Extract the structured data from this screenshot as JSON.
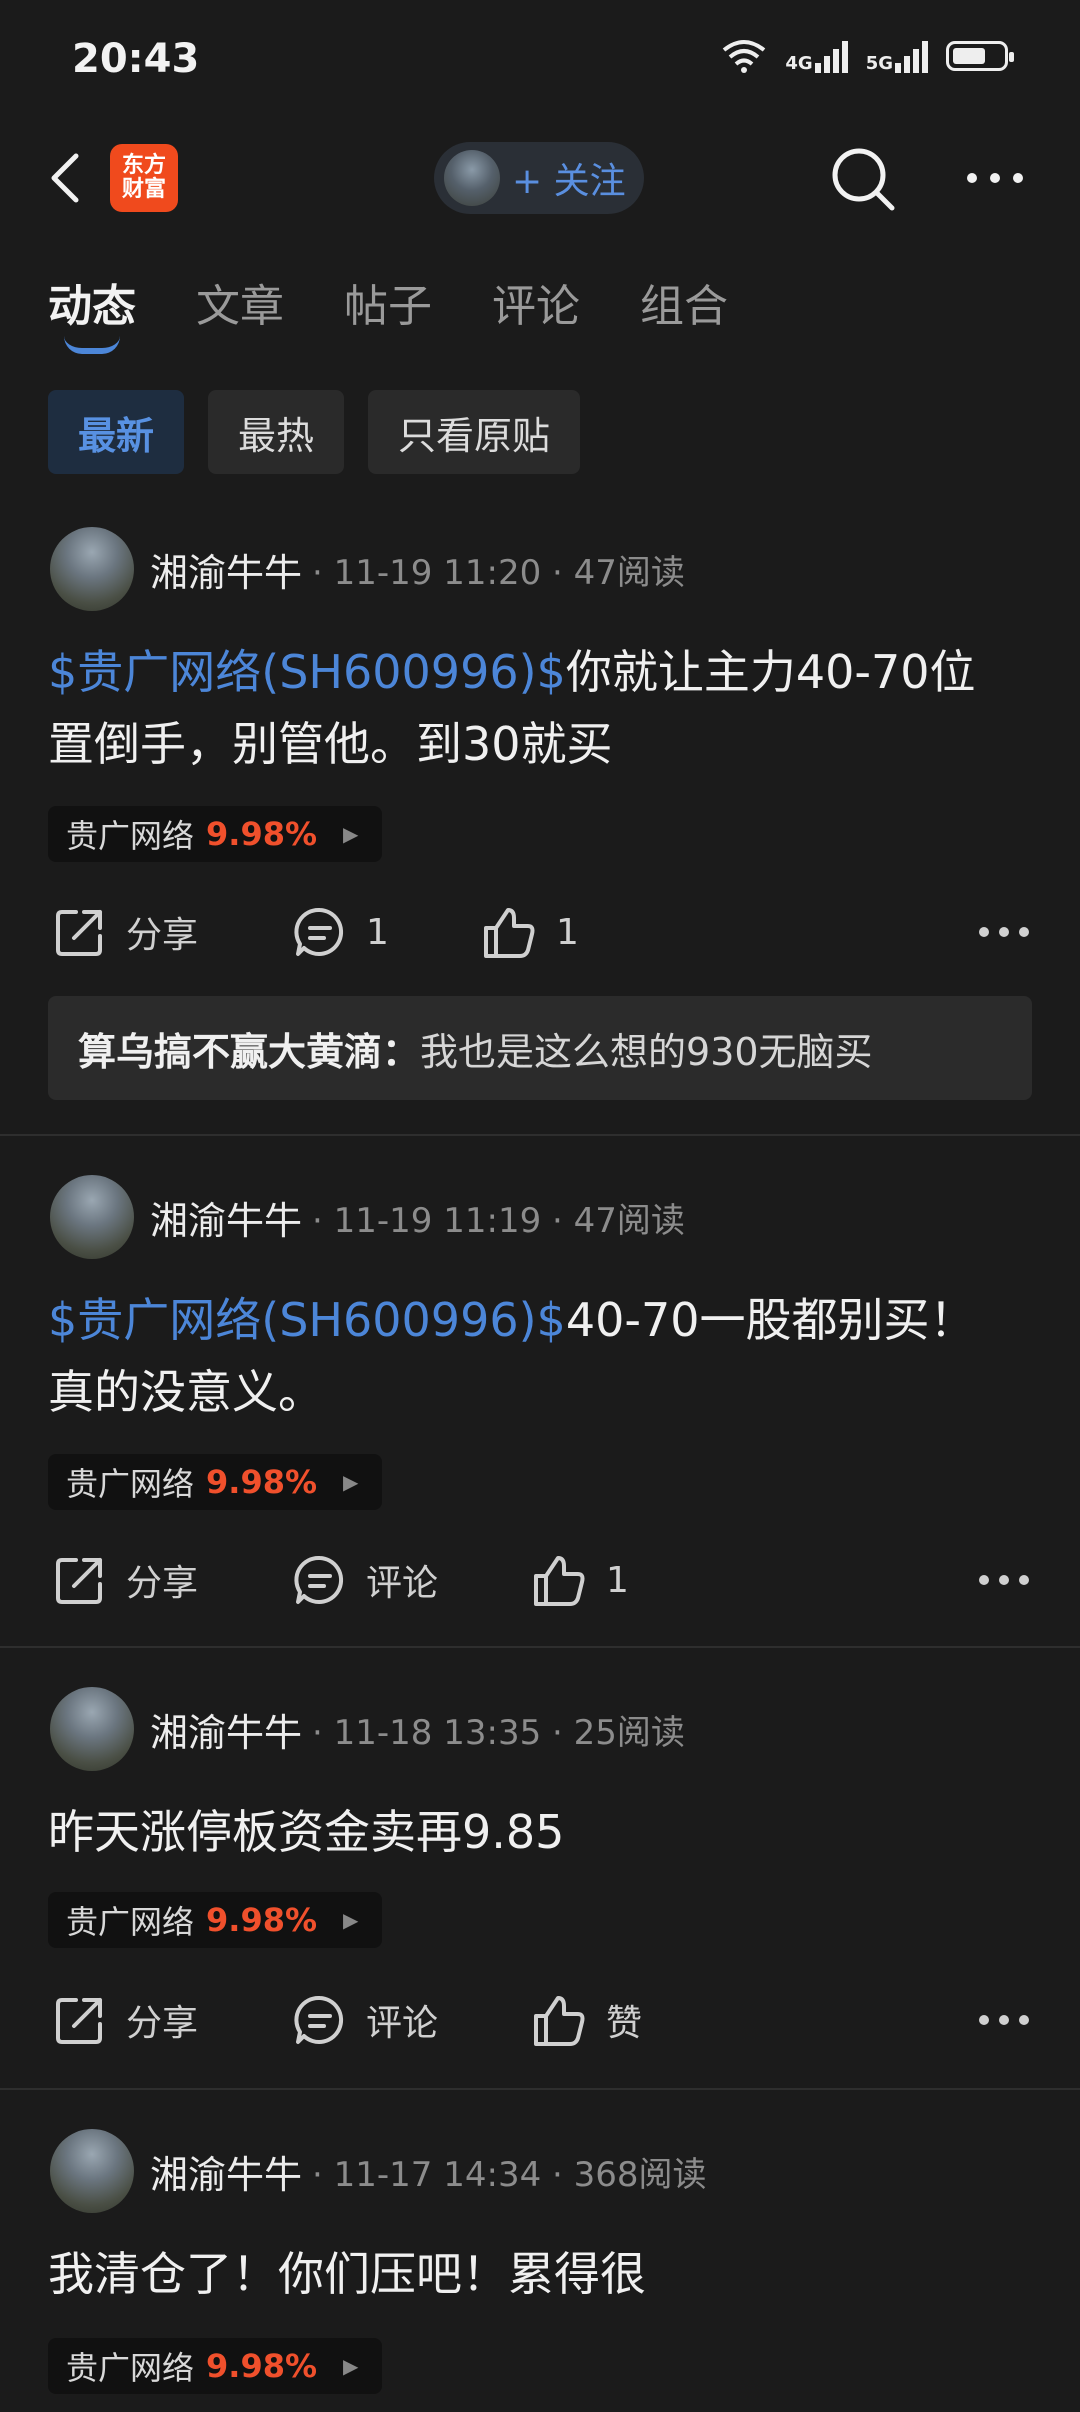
{
  "status_bar": {
    "time": "20:43",
    "net1": "4G",
    "net2": "5G"
  },
  "nav": {
    "logo_line1": "东方",
    "logo_line2": "财富",
    "follow_label": "+ 关注"
  },
  "tabs": [
    {
      "label": "动态"
    },
    {
      "label": "文章"
    },
    {
      "label": "帖子"
    },
    {
      "label": "评论"
    },
    {
      "label": "组合"
    }
  ],
  "filters": [
    {
      "label": "最新"
    },
    {
      "label": "最热"
    },
    {
      "label": "只看原贴"
    }
  ],
  "posts": [
    {
      "author": "湘渝牛牛",
      "time": "· 11-19 11:20 · 47阅读",
      "stock_link": "$贵广网络(SH600996)$",
      "text": "你就让主力40-70位置倒手，别管他。到30就买",
      "chip_name": "贵广网络",
      "chip_pct": "9.98%",
      "share": "分享",
      "comment": "1",
      "like": "1",
      "reply_author": "算乌搞不赢大黄滴：",
      "reply_text": "我也是这么想的930无脑买"
    },
    {
      "author": "湘渝牛牛",
      "time": "· 11-19 11:19 · 47阅读",
      "stock_link": "$贵广网络(SH600996)$",
      "text": "40-70一股都别买！真的没意义。",
      "chip_name": "贵广网络",
      "chip_pct": "9.98%",
      "share": "分享",
      "comment": "评论",
      "like": "1"
    },
    {
      "author": "湘渝牛牛",
      "time": "· 11-18 13:35 · 25阅读",
      "text": "昨天涨停板资金卖再9.85",
      "chip_name": "贵广网络",
      "chip_pct": "9.98%",
      "share": "分享",
      "comment": "评论",
      "like": "赞"
    },
    {
      "author": "湘渝牛牛",
      "time": "· 11-17 14:34 · 368阅读",
      "text": "我清仓了！你们压吧！累得很",
      "chip_name": "贵广网络",
      "chip_pct": "9.98%"
    }
  ],
  "colors": {
    "accent": "#4c86d8",
    "up_red": "#f0502c",
    "logo": "#f04a1d",
    "bg": "#1b1b1b"
  }
}
